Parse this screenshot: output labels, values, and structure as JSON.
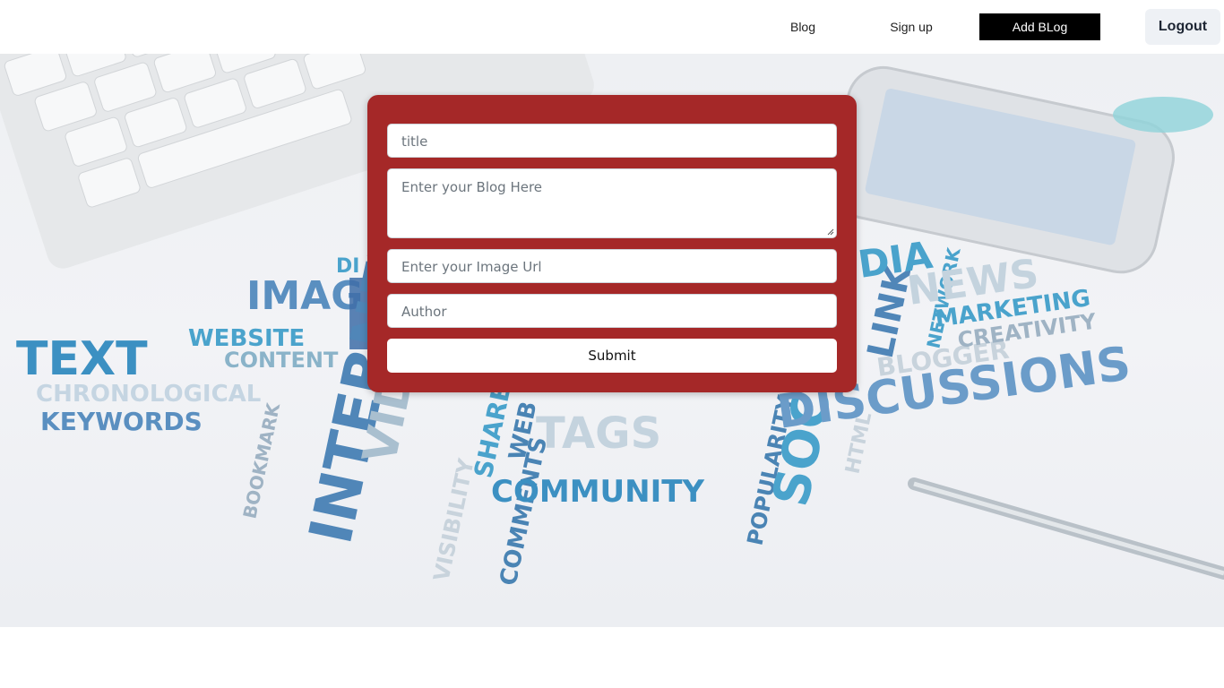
{
  "navbar": {
    "blog_label": "Blog",
    "signup_label": "Sign up",
    "add_blog_label": "Add BLog",
    "logout_label": "Logout"
  },
  "hero": {
    "image_words": [
      "TEXT",
      "WEBSITE",
      "CONTENT",
      "IMAG",
      "CHRONOLOGICAL",
      "KEYWORDS",
      "INTERNET",
      "VIDEOS",
      "BOOKMARK",
      "VISIBILITY",
      "COMMENTS",
      "SHARE",
      "WEB",
      "COMMUNITY",
      "TAGS",
      "POPULARITY",
      "SOCIAL",
      "DISCUSSIONS",
      "HTML",
      "BLOGGER",
      "LINK",
      "NETWORK",
      "NEWS",
      "MARKETING",
      "CREATIVITY",
      "DIA",
      "DI"
    ]
  },
  "form": {
    "title_placeholder": "title",
    "blog_placeholder": "Enter your Blog Here",
    "image_placeholder": "Enter your Image Url",
    "author_placeholder": "Author",
    "submit_label": "Submit"
  },
  "colors": {
    "card": "#a52828",
    "add_blog_bg": "#000000",
    "logout_bg": "#eef1f5"
  }
}
